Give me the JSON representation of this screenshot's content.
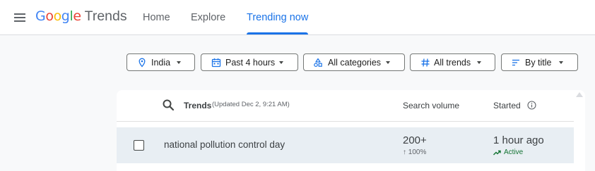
{
  "header": {
    "logo": {
      "letters": [
        {
          "char": "G",
          "color": "#4285F4"
        },
        {
          "char": "o",
          "color": "#EA4335"
        },
        {
          "char": "o",
          "color": "#FBBC05"
        },
        {
          "char": "g",
          "color": "#4285F4"
        },
        {
          "char": "l",
          "color": "#34A853"
        },
        {
          "char": "e",
          "color": "#EA4335"
        }
      ],
      "product": "Trends"
    },
    "nav": [
      {
        "label": "Home",
        "active": false
      },
      {
        "label": "Explore",
        "active": false
      },
      {
        "label": "Trending now",
        "active": true
      }
    ]
  },
  "filters": [
    {
      "icon": "location-pin-icon",
      "label": "India"
    },
    {
      "icon": "calendar-icon",
      "label": "Past 4 hours"
    },
    {
      "icon": "categories-icon",
      "label": "All categories"
    },
    {
      "icon": "hashtag-icon",
      "label": "All trends"
    },
    {
      "icon": "sort-icon",
      "label": "By title"
    }
  ],
  "table": {
    "title": "Trends",
    "updated": "(Updated Dec 2, 9:21 AM)",
    "columns": {
      "volume": "Search volume",
      "started": "Started"
    },
    "rows": [
      {
        "title": "national pollution control day",
        "volume": "200+",
        "change": "↑ 100%",
        "started": "1 hour ago",
        "status": "Active"
      }
    ]
  },
  "colors": {
    "accent": "#1a73e8",
    "active_status": "#137333",
    "row_highlight": "#e8eef3",
    "page_background": "#f8f9fa"
  }
}
